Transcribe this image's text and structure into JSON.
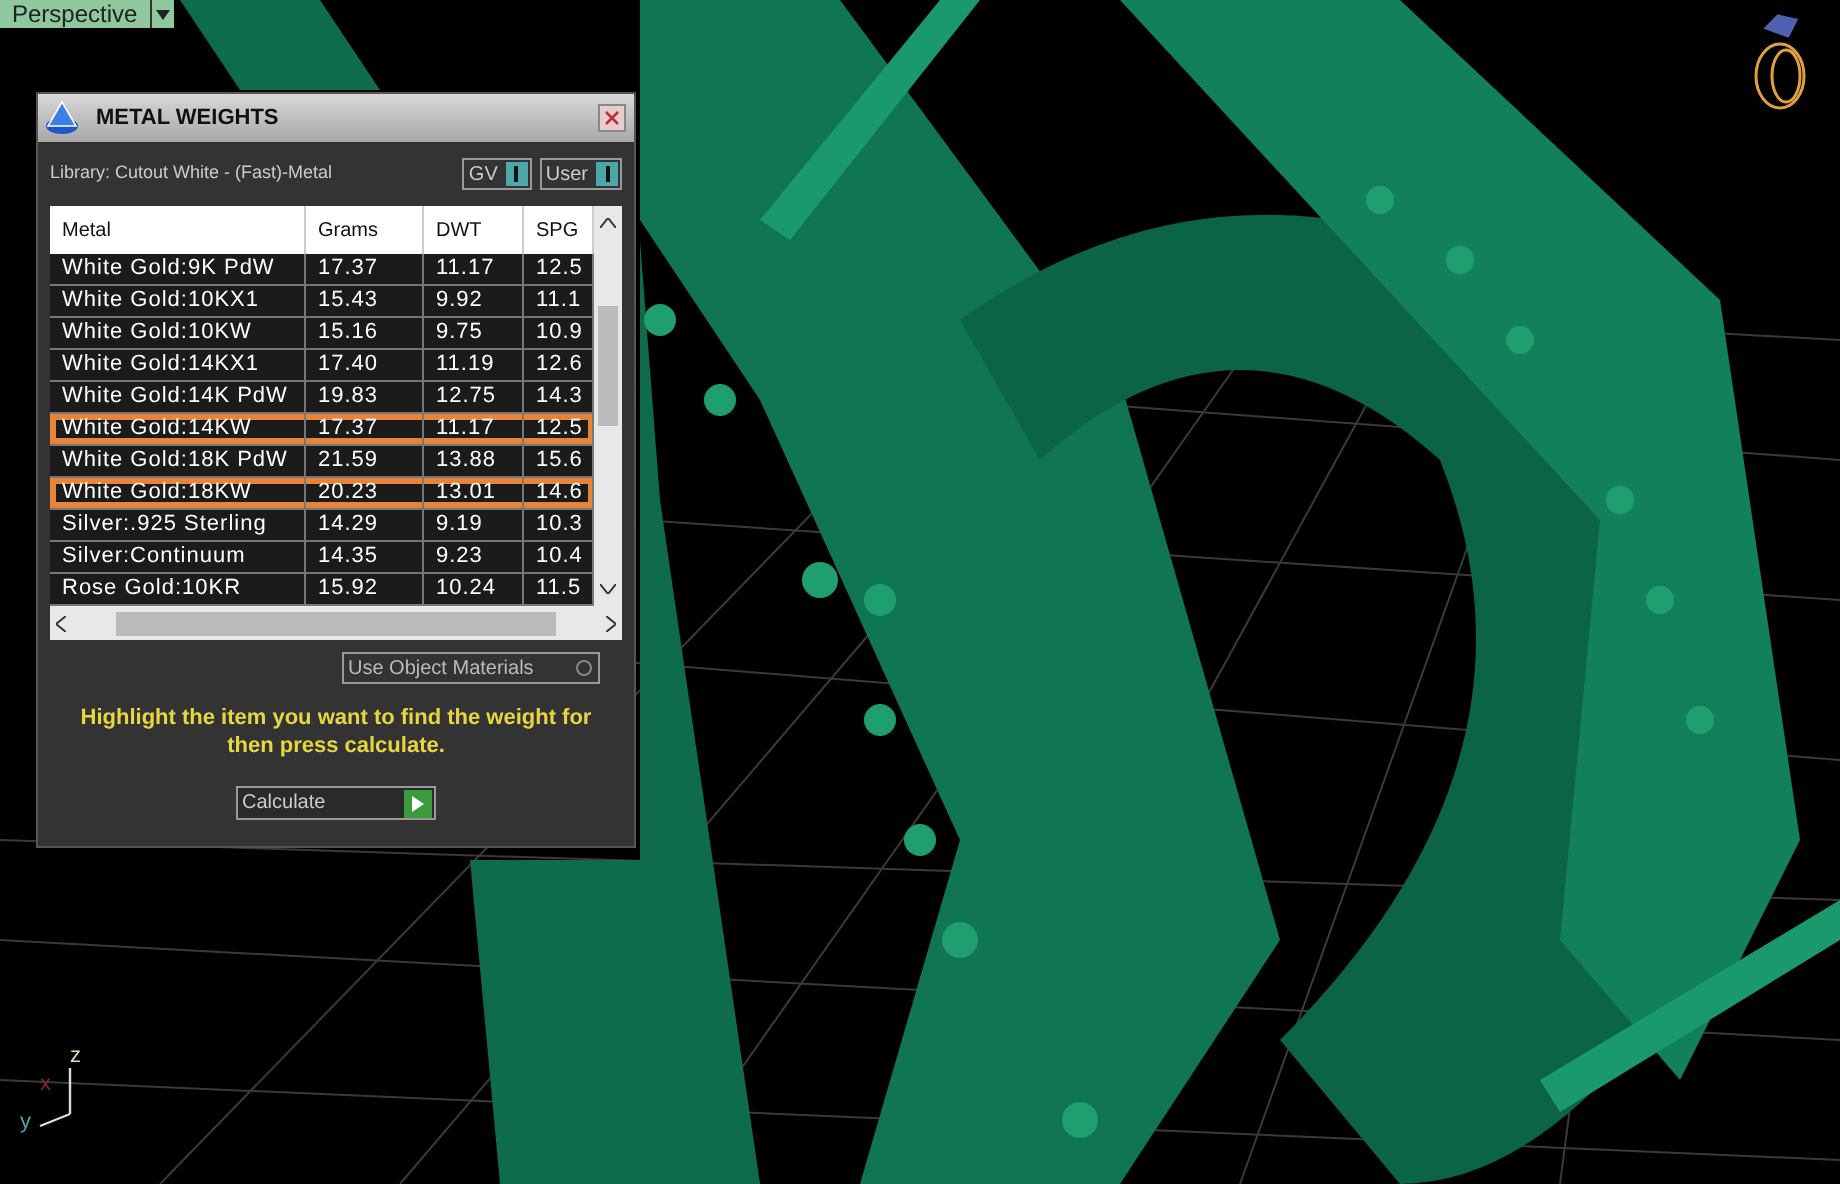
{
  "viewport": {
    "label": "Perspective",
    "axes": [
      "z",
      "x",
      "y"
    ]
  },
  "panel": {
    "title": "METAL WEIGHTS",
    "library": "Library: Cutout White - (Fast)-Metal",
    "toggles": [
      {
        "label": "GV",
        "on": true
      },
      {
        "label": "User",
        "on": true
      }
    ],
    "table": {
      "columns": [
        "Metal",
        "Grams",
        "DWT",
        "SPG"
      ],
      "rows": [
        {
          "cells": [
            "White Gold:9K PdW",
            "17.37",
            "11.17",
            "12.5"
          ],
          "highlighted": false
        },
        {
          "cells": [
            "White Gold:10KX1",
            "15.43",
            "9.92",
            "11.1"
          ],
          "highlighted": false
        },
        {
          "cells": [
            "White Gold:10KW",
            "15.16",
            "9.75",
            "10.9"
          ],
          "highlighted": false
        },
        {
          "cells": [
            "White Gold:14KX1",
            "17.40",
            "11.19",
            "12.6"
          ],
          "highlighted": false
        },
        {
          "cells": [
            "White Gold:14K PdW",
            "19.83",
            "12.75",
            "14.3"
          ],
          "highlighted": false
        },
        {
          "cells": [
            "White Gold:14KW",
            "17.37",
            "11.17",
            "12.5"
          ],
          "highlighted": true
        },
        {
          "cells": [
            "White Gold:18K PdW",
            "21.59",
            "13.88",
            "15.6"
          ],
          "highlighted": false
        },
        {
          "cells": [
            "White Gold:18KW",
            "20.23",
            "13.01",
            "14.6"
          ],
          "highlighted": true
        },
        {
          "cells": [
            "Silver:.925 Sterling",
            "14.29",
            "9.19",
            "10.3"
          ],
          "highlighted": false
        },
        {
          "cells": [
            "Silver:Continuum",
            "14.35",
            "9.23",
            "10.4"
          ],
          "highlighted": false
        },
        {
          "cells": [
            "Rose Gold:10KR",
            "15.92",
            "10.24",
            "11.5"
          ],
          "highlighted": false
        }
      ]
    },
    "use_object_materials": {
      "label": "Use Object Materials",
      "checked": false
    },
    "message": "Highlight the item you want to find the weight for then press calculate.",
    "calculate_button": "Calculate"
  }
}
